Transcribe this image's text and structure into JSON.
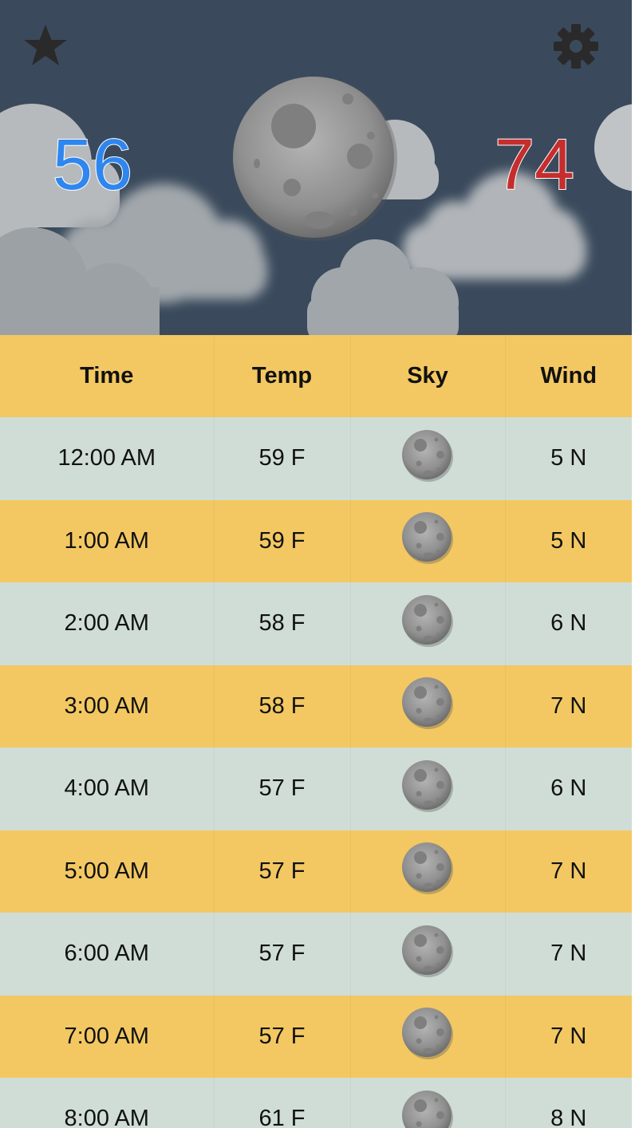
{
  "header": {
    "low_temp": "56",
    "high_temp": "74",
    "favorite_icon": "star-icon",
    "settings_icon": "gear-icon",
    "condition_icon": "moon-icon",
    "colors": {
      "background": "#3a4a5c",
      "low_temp": "#2f86ee",
      "high_temp": "#c62d2d"
    }
  },
  "table": {
    "columns": [
      "Time",
      "Temp",
      "Sky",
      "Wind"
    ],
    "rows": [
      {
        "time": "12:00 AM",
        "temp": "59 F",
        "sky": "moon-icon",
        "wind": "5 N"
      },
      {
        "time": "1:00 AM",
        "temp": "59 F",
        "sky": "moon-icon",
        "wind": "5 N"
      },
      {
        "time": "2:00 AM",
        "temp": "58 F",
        "sky": "moon-icon",
        "wind": "6 N"
      },
      {
        "time": "3:00 AM",
        "temp": "58 F",
        "sky": "moon-icon",
        "wind": "7 N"
      },
      {
        "time": "4:00 AM",
        "temp": "57 F",
        "sky": "moon-icon",
        "wind": "6 N"
      },
      {
        "time": "5:00 AM",
        "temp": "57 F",
        "sky": "moon-icon",
        "wind": "7 N"
      },
      {
        "time": "6:00 AM",
        "temp": "57 F",
        "sky": "moon-icon",
        "wind": "7 N"
      },
      {
        "time": "7:00 AM",
        "temp": "57 F",
        "sky": "moon-icon",
        "wind": "7 N"
      },
      {
        "time": "8:00 AM",
        "temp": "61 F",
        "sky": "moon-icon",
        "wind": "8 N"
      }
    ],
    "colors": {
      "header_bg": "#f3c862",
      "row_even_bg": "#cfddd6",
      "row_odd_bg": "#f3c862"
    }
  }
}
